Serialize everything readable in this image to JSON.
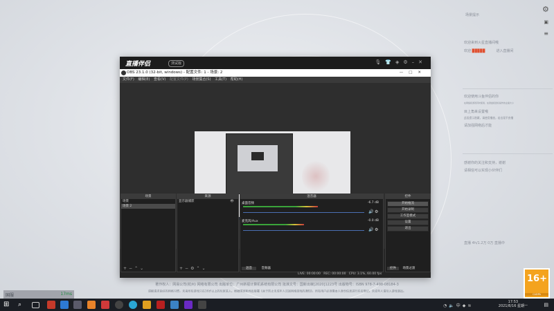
{
  "right_panel": {
    "header": "场景提示",
    "lines_a": [
      "欢迎来到火星直播间哦",
      "欢迎",
      "进入直播间"
    ],
    "lines_b": [
      "欢迎使用斗鱼伴侣的你",
      "在网络和游戏同时使用，在键盘和鼠标操作的主播大小",
      "目上角来设置哦",
      "此段提示隐藏，请使用播放，若出现不良播",
      "请加强网络后才能"
    ],
    "lines_c": [
      "感谢你的关注和支持，谢谢",
      "请相信可以实现小伙伴们"
    ],
    "bottom_line": "直播 4h/1.2万 0万 直播中"
  },
  "zhibo": {
    "logo": "直播伴侣",
    "badge": "测试版",
    "icons": [
      "mic-icon",
      "shirt-icon",
      "gift-icon",
      "settings-icon",
      "minimize-icon",
      "close-icon"
    ]
  },
  "obs": {
    "title": "OBS 23.1.0 (32-bit, windows) - 配置文件: 1 - 场景: 2",
    "window_controls": [
      "—",
      "□",
      "✕"
    ],
    "menu": [
      "文件(F)",
      "编辑(E)",
      "查看(V)",
      "配置文件(P)",
      "场景集合(S)",
      "工具(T)",
      "帮助(H)"
    ],
    "docks": {
      "scenes": {
        "title": "场景",
        "items": [
          "场景",
          "场景 2"
        ]
      },
      "sources": {
        "title": "来源",
        "items": [
          "显示器捕获"
        ]
      },
      "mixer": {
        "title": "混音器",
        "channels": [
          {
            "name": "桌面音频",
            "db": "-6.7 dB",
            "level": 0.55
          },
          {
            "name": "麦克风/Aux",
            "db": "-0.0 dB",
            "level": 0.45
          }
        ],
        "tabs": [
          "混音",
          "音频器"
        ]
      },
      "controls": {
        "title": "控件",
        "buttons": [
          "开始推流",
          "开始录制",
          "工作室模式",
          "设置",
          "退出"
        ],
        "tabs": [
          "控件",
          "场景过渡"
        ]
      }
    },
    "status": {
      "live": "LIVE: 00:00:00",
      "rec": "REC: 00:00:00",
      "cpu": "CPU: 3.1%, 60.00 fps"
    }
  },
  "footer": {
    "line1": "著作权人：网易公司(杭州) 网络有限公司 出版单位：广州新视计算机系统有限公司 批准文号：国新出审[2020]1223号 出版物号：ISBN 978-7-498-08184-3",
    "line2": "请解请求良好的网络习惯，未来所有游戏只在16岁以上的玩家进入。根据国家新闻出版署《关于防止未成年人沉迷网络游戏的通知》，所有用户必须需本人身份信息进行实名登记。未成年人请勿入游戏演出。"
  },
  "country": {
    "label": "国服",
    "value": "17ms"
  },
  "age_badge": {
    "number": "16+",
    "caption": "CADPA"
  },
  "taskbar": {
    "time": "17:53",
    "date": "2021/8/16 星期一"
  }
}
